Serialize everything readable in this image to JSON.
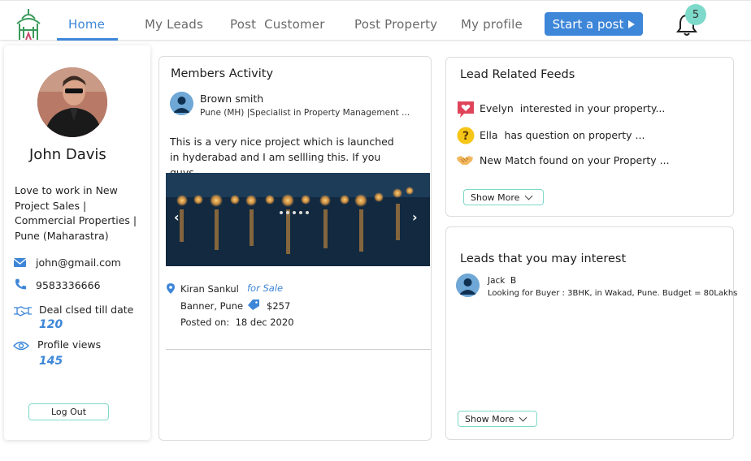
{
  "nav": {
    "items": [
      {
        "label": "Home",
        "active": true
      },
      {
        "label": "My Leads"
      },
      {
        "label": "Post  Customer"
      },
      {
        "label": "Post Property"
      },
      {
        "label": "My profile"
      }
    ],
    "start_post_label": "Start a post",
    "notification_count": "5"
  },
  "profile": {
    "name": "John Davis",
    "bio": "Love to work in New Project Sales | Commercial Properties | Pune (Maharastra)",
    "email": "john@gmail.com",
    "phone": "9583336666",
    "deals_label": "Deal clsed till date",
    "deals_value": "120",
    "views_label": "Profile views",
    "views_value": "145",
    "logout_label": "Log Out"
  },
  "members_activity": {
    "title": "Members Activity",
    "author_name": "Brown smith",
    "author_subtitle": "Pune (MH) |Specialist in Property Management ...",
    "post_text": "This is a very nice project which is launched in hyderabad and I am sellling this. If you guys ...",
    "location_name": "Kiran Sankul",
    "location_area": "Banner, Pune",
    "sale_tag": "for Sale",
    "price": "$257",
    "posted_on": "Posted on:  18 dec 2020"
  },
  "lead_feeds": {
    "title": "Lead Related Feeds",
    "items": [
      {
        "icon": "heart-chat-icon",
        "text": "Evelyn  interested in your property..."
      },
      {
        "icon": "question-icon",
        "text": "Ella  has question on property ..."
      },
      {
        "icon": "handshake-icon",
        "text": "New Match found on your Property ..."
      }
    ],
    "show_more_label": "Show More"
  },
  "leads_interest": {
    "title": "Leads that you may interest",
    "lead_name": "Jack  B",
    "lead_text": "Looking for Buyer : 3BHK, in Wakad, Pune. Budget = 80Lakhs",
    "show_more_label": "Show More"
  },
  "colors": {
    "accent": "#3d86d8",
    "teal": "#7dd9c9"
  }
}
